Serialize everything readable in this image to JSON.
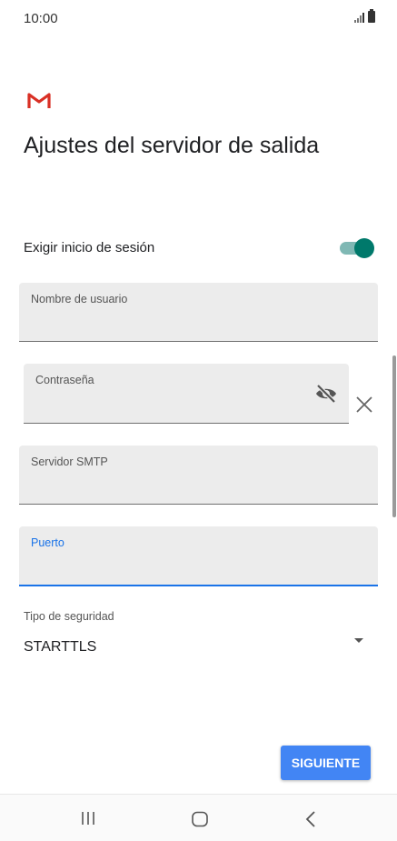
{
  "status_bar": {
    "time": "10:00",
    "signal_icon": "signal-icon",
    "battery_icon": "battery-icon"
  },
  "app": {
    "logo_icon": "gmail-logo-icon",
    "brand_color": "#d93025"
  },
  "page": {
    "title": "Ajustes del servidor de salida"
  },
  "login_toggle": {
    "label": "Exigir inicio de sesión",
    "enabled": true,
    "accent": "#00796b"
  },
  "fields": {
    "username": {
      "label": "Nombre de usuario",
      "value": ""
    },
    "password": {
      "label": "Contraseña",
      "value": "",
      "visibility_icon": "eye-off-icon",
      "clear_icon": "close-icon"
    },
    "smtp": {
      "label": "Servidor SMTP",
      "value": ""
    },
    "port": {
      "label": "Puerto",
      "value": "",
      "focused": true,
      "focus_color": "#1a73e8"
    }
  },
  "security": {
    "label": "Tipo de seguridad",
    "value": "STARTTLS",
    "dropdown_icon": "dropdown-arrow-icon"
  },
  "actions": {
    "next_label": "SIGUIENTE",
    "button_color": "#4285f4"
  },
  "nav_bar": {
    "recents_icon": "recents-icon",
    "home_icon": "home-icon",
    "back_icon": "back-icon"
  }
}
